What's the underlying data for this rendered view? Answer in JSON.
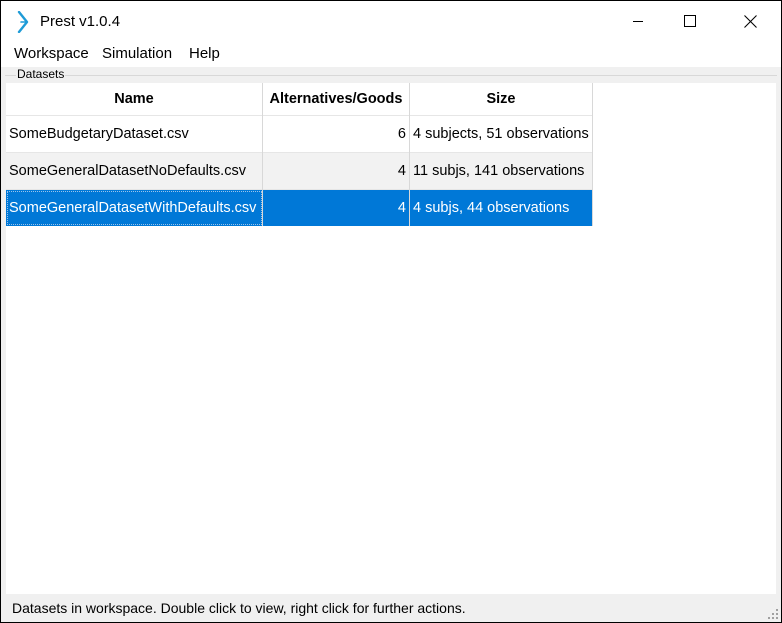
{
  "window": {
    "title": "Prest v1.0.4",
    "icon": "prest-logo-icon",
    "controls": [
      "minimize-icon",
      "maximize-icon",
      "close-icon"
    ]
  },
  "menu": {
    "items": [
      "Workspace",
      "Simulation",
      "Help"
    ]
  },
  "datasets": {
    "group_label": "Datasets",
    "columns": [
      "Name",
      "Alternatives/Goods",
      "Size"
    ],
    "rows": [
      {
        "name": "SomeBudgetaryDataset.csv",
        "alternatives": "6",
        "size": "4 subjects, 51 observations",
        "selected": false
      },
      {
        "name": "SomeGeneralDatasetNoDefaults.csv",
        "alternatives": "4",
        "size": "11 subjs, 141 observations",
        "selected": false
      },
      {
        "name": "SomeGeneralDatasetWithDefaults.csv",
        "alternatives": "4",
        "size": "4 subjs, 44 observations",
        "selected": true
      }
    ]
  },
  "status": {
    "text": "Datasets in workspace. Double click to view, right click for further actions."
  },
  "colors": {
    "selection": "#0078d7",
    "icon_accent": "#1e9bd7"
  }
}
